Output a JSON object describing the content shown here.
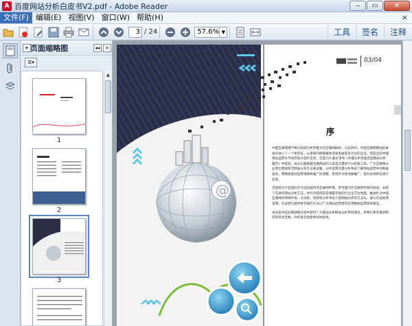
{
  "window": {
    "title": "百度网站分析白皮书V2.pdf - Adobe Reader",
    "app_icon": "A"
  },
  "menu": {
    "items": [
      "文件(F)",
      "编辑(E)",
      "视图(V)",
      "窗口(W)",
      "帮助(H)"
    ],
    "close_glyph": "×"
  },
  "toolbar": {
    "current_page": "3",
    "total_pages": "/ 24",
    "zoom": "57.6%",
    "links": [
      "工具",
      "签名",
      "注释"
    ]
  },
  "thumbnails": {
    "panel_title": "页面缩略图",
    "labels": [
      "1",
      "2",
      "3"
    ]
  },
  "document": {
    "page_number": "03/04",
    "heading": "序",
    "paragraphs": [
      "中国互联网用户数已经成为世界最大的互联网群体，与此同时，中国互联网网站的发展也进入了一个新阶段，从单纯的网络媒体渐渐发展到多元化的业态。但是当前中国网站运营水平尚存较大提升空间。百度CDC最近发布《中国分析调查百度网站分析报告》中提及，站长们越来越注重网站的工具是流量统计分析类工具。广大互联网从业者也需要简洁网站分析方法来试着，分析运用流量分析系统了解网站运营中的数据驱动，用数据驱动运营策略和推广的调整，更有针对性地做推广，提升达到和在进行反馈。",
      "百度统计产品团队针对当前国内的互联网环境，参考国内外互联网专家的经验，总结了先进的网站分析方法，并针对获得常常掌握丰富的行业全方位地面，推进针对中国互联网的特殊环境、从流程、资源等分析手段介绍网站分析的方法论，诚以实战案例说明，为读者们提供更丰富的方法以广大网站运营者有在用数据运营提供建议。",
      "本白皮书在前期调研过程中获得了大量站长和网站分析界的建议，供我们参考最新研究的有效无数，你的意见会使更好地指导。"
    ],
    "colors": {
      "navy": "#2a2d45",
      "accent": "#5bc6e6",
      "tab_gray": "#cfd6dc"
    }
  }
}
